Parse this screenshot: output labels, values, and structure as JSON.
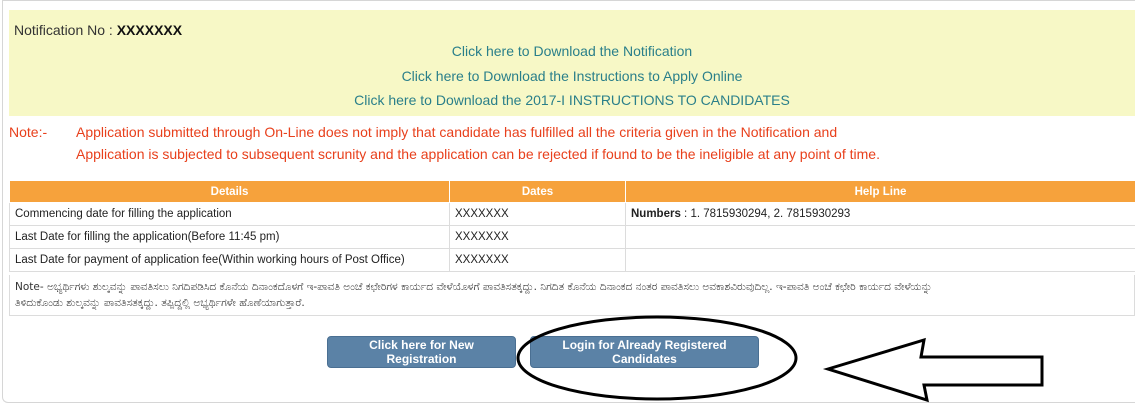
{
  "notice": {
    "notification_label": "Notification No : ",
    "notification_value": "XXXXXXX",
    "links": [
      "Click here to Download the Notification",
      "Click here to Download the Instructions to Apply Online",
      "Click here to Download the 2017-I INSTRUCTIONS TO CANDIDATES"
    ]
  },
  "note": {
    "label": "Note:-",
    "line1": "Application submitted through On-Line does not imply that candidate has fulfilled all the criteria given in the Notification and",
    "line2": "Application is subjected to subsequent scrunity and the application can be rejected if found to be the ineligible at any point of time."
  },
  "table": {
    "headers": [
      "Details",
      "Dates",
      "Help Line"
    ],
    "rows": [
      {
        "detail": "Commencing date for filling the application",
        "date": "XXXXXXX",
        "help_label": "Numbers",
        "help_value": " : 1. 7815930294, 2. 7815930293"
      },
      {
        "detail": "Last Date for filling the application(Before 11:45 pm)",
        "date": "XXXXXXX"
      },
      {
        "detail": "Last Date for payment of application fee(Within working hours of Post Office)",
        "date": "XXXXXXX"
      }
    ]
  },
  "kannada_note": {
    "line1": "Note- ಅಭ್ಯರ್ಥಿಗಳು ಶುಲ್ಕವನ್ನು ಪಾವತಿಸಲು ನಿಗದಿಪಡಿಸಿದ ಕೊನೆಯ ದಿನಾಂಕದೊಳಗೆ ಇ-ಪಾವತಿ ಅಂಚೆ ಕಛೇರಿಗಳ ಕಾರ್ಯದ ವೇಳೆಯೊಳಗೆ ಪಾವತಿಸತಕ್ಕದ್ದು. ನಿಗದಿತ ಕೊನೆಯ ದಿನಾಂಕದ ನಂತರ ಪಾವತಿಸಲು ಅವಕಾಶವಿರುವುದಿಲ್ಲ. ಇ-ಪಾವತಿ ಅಂಚೆ ಕಛೇರಿ ಕಾರ್ಯದ ವೇಳೆಯನ್ನು",
    "line2": "ತಿಳಿದುಕೊಂಡು ಶುಲ್ಕವನ್ನು ಪಾವತಿಸತಕ್ಕದ್ದು. ತಪ್ಪಿದ್ದಲ್ಲಿ ಅಭ್ಯರ್ಥಿಗಳೇ ಹೊಣೆಯಾಗುತ್ತಾರೆ."
  },
  "buttons": {
    "new_registration": "Click here for New Registration",
    "login": "Login for Already Registered Candidates"
  },
  "colors": {
    "notice_bg": "#f7f8c6",
    "link": "#2a7f8a",
    "note_red": "#e8401c",
    "table_header": "#f6a23c",
    "button": "#5b82a6"
  }
}
